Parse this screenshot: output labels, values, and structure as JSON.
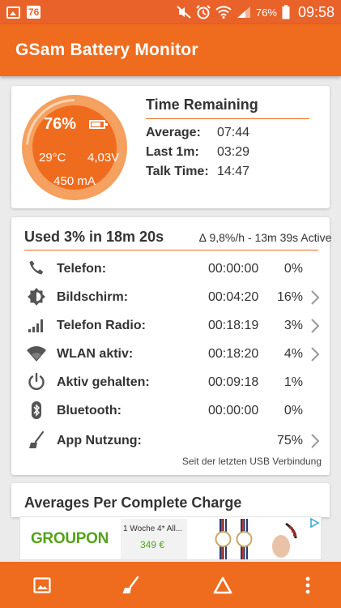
{
  "status_bar": {
    "notification_badge": "76",
    "battery_percent": "76%",
    "time": "09:58",
    "icons": [
      "gallery-icon",
      "mute-icon",
      "alarm-icon",
      "wifi-icon",
      "signal-icon",
      "battery-icon"
    ]
  },
  "app": {
    "title": "GSam Battery Monitor"
  },
  "gauge": {
    "percent": "76%",
    "level": 0.76,
    "temperature": "29°C",
    "voltage": "4,03V",
    "current": "450 mA"
  },
  "time_remaining": {
    "title": "Time Remaining",
    "rows": [
      {
        "label": "Average:",
        "value": "07:44"
      },
      {
        "label": "Last 1m:",
        "value": "03:29"
      },
      {
        "label": "Talk Time:",
        "value": "14:47"
      }
    ]
  },
  "usage": {
    "title": "Used 3% in 18m 20s",
    "rate": "∆ 9,8%/h - 13m 39s Active",
    "rows": [
      {
        "name": "Telefon:",
        "time": "00:00:00",
        "percent": "0%",
        "icon": "phone-icon",
        "chevron": false
      },
      {
        "name": "Bildschirm:",
        "time": "00:04:20",
        "percent": "16%",
        "icon": "brightness-icon",
        "chevron": true
      },
      {
        "name": "Telefon Radio:",
        "time": "00:18:19",
        "percent": "3%",
        "icon": "signal-bars-icon",
        "chevron": true
      },
      {
        "name": "WLAN aktiv:",
        "time": "00:18:20",
        "percent": "4%",
        "icon": "wifi-icon",
        "chevron": true
      },
      {
        "name": "Aktiv gehalten:",
        "time": "00:09:18",
        "percent": "1%",
        "icon": "power-icon",
        "chevron": false
      },
      {
        "name": "Bluetooth:",
        "time": "00:00:00",
        "percent": "0%",
        "icon": "bluetooth-icon",
        "chevron": false
      },
      {
        "name": "App Nutzung:",
        "time": "",
        "percent": "75%",
        "icon": "broom-icon",
        "chevron": true
      }
    ],
    "footnote": "Seit der letzten USB Verbindung"
  },
  "averages": {
    "title": "Averages Per Complete Charge"
  },
  "ad": {
    "brand": "GROUPON",
    "deal_text": "1 Woche 4* All...",
    "price": "349 €"
  },
  "bottom_nav": [
    "gallery-icon",
    "broom-icon",
    "delta-icon",
    "more-vert-icon"
  ],
  "colors": {
    "accent": "#ef6c1f",
    "statusbar": "#e8622a",
    "gauge_outer": "#f5a05e",
    "gauge_inner": "#ef6c1f",
    "groupon": "#53a318"
  }
}
